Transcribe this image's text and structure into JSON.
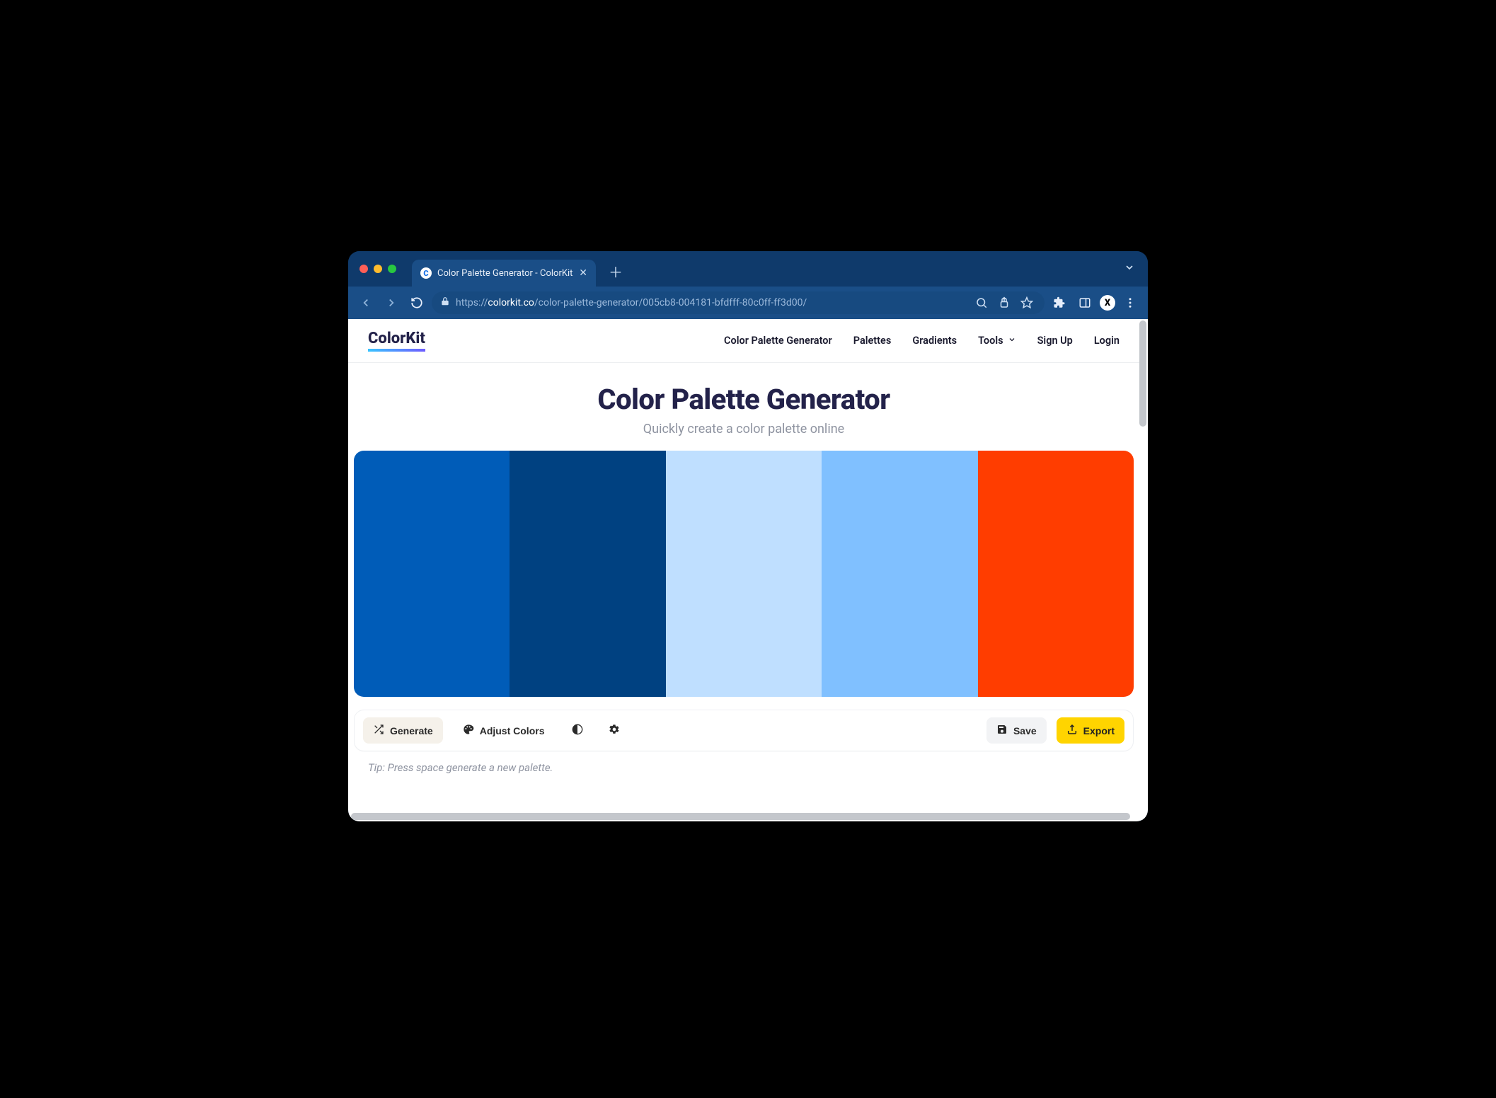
{
  "browser": {
    "tab_title": "Color Palette Generator - ColorKit",
    "url_prefix": "https://",
    "url_host": "colorkit.co",
    "url_path": "/color-palette-generator/005cb8-004181-bfdfff-80c0ff-ff3d00/",
    "avatar_letter": "X",
    "favicon_letter": "C"
  },
  "site": {
    "logo": "ColorKit",
    "nav": {
      "generator": "Color Palette Generator",
      "palettes": "Palettes",
      "gradients": "Gradients",
      "tools": "Tools",
      "signup": "Sign Up",
      "login": "Login"
    }
  },
  "hero": {
    "title": "Color Palette Generator",
    "subtitle": "Quickly create a color palette online"
  },
  "palette": {
    "colors": [
      "#005cb8",
      "#004181",
      "#bfdfff",
      "#80c0ff",
      "#ff3d00"
    ]
  },
  "controls": {
    "generate": "Generate",
    "adjust": "Adjust Colors",
    "save": "Save",
    "export": "Export"
  },
  "tip": "Tip: Press space generate a new palette."
}
